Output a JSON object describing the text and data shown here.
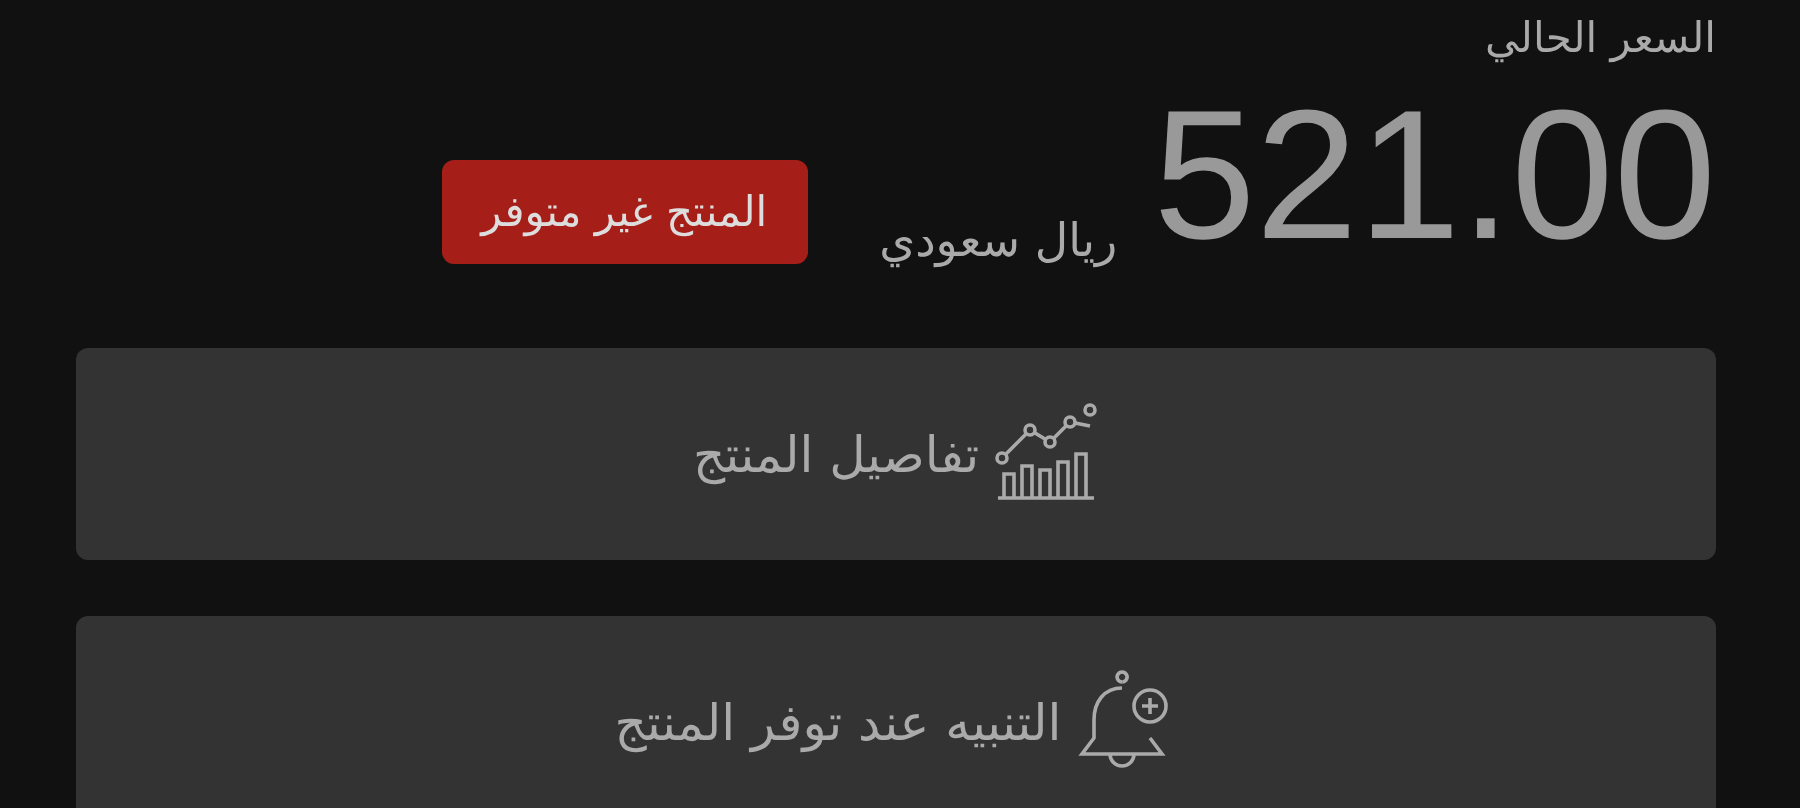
{
  "price_label": "السعر الحالي",
  "price": {
    "amount": "521.00",
    "currency": "ريال سعودي"
  },
  "availability_badge": {
    "label": "المنتج غير متوفر",
    "available": false
  },
  "actions": [
    {
      "label": "تفاصيل المنتج",
      "kind": "chart"
    },
    {
      "label": "التنبيه عند توفر المنتج",
      "kind": "bell"
    }
  ]
}
